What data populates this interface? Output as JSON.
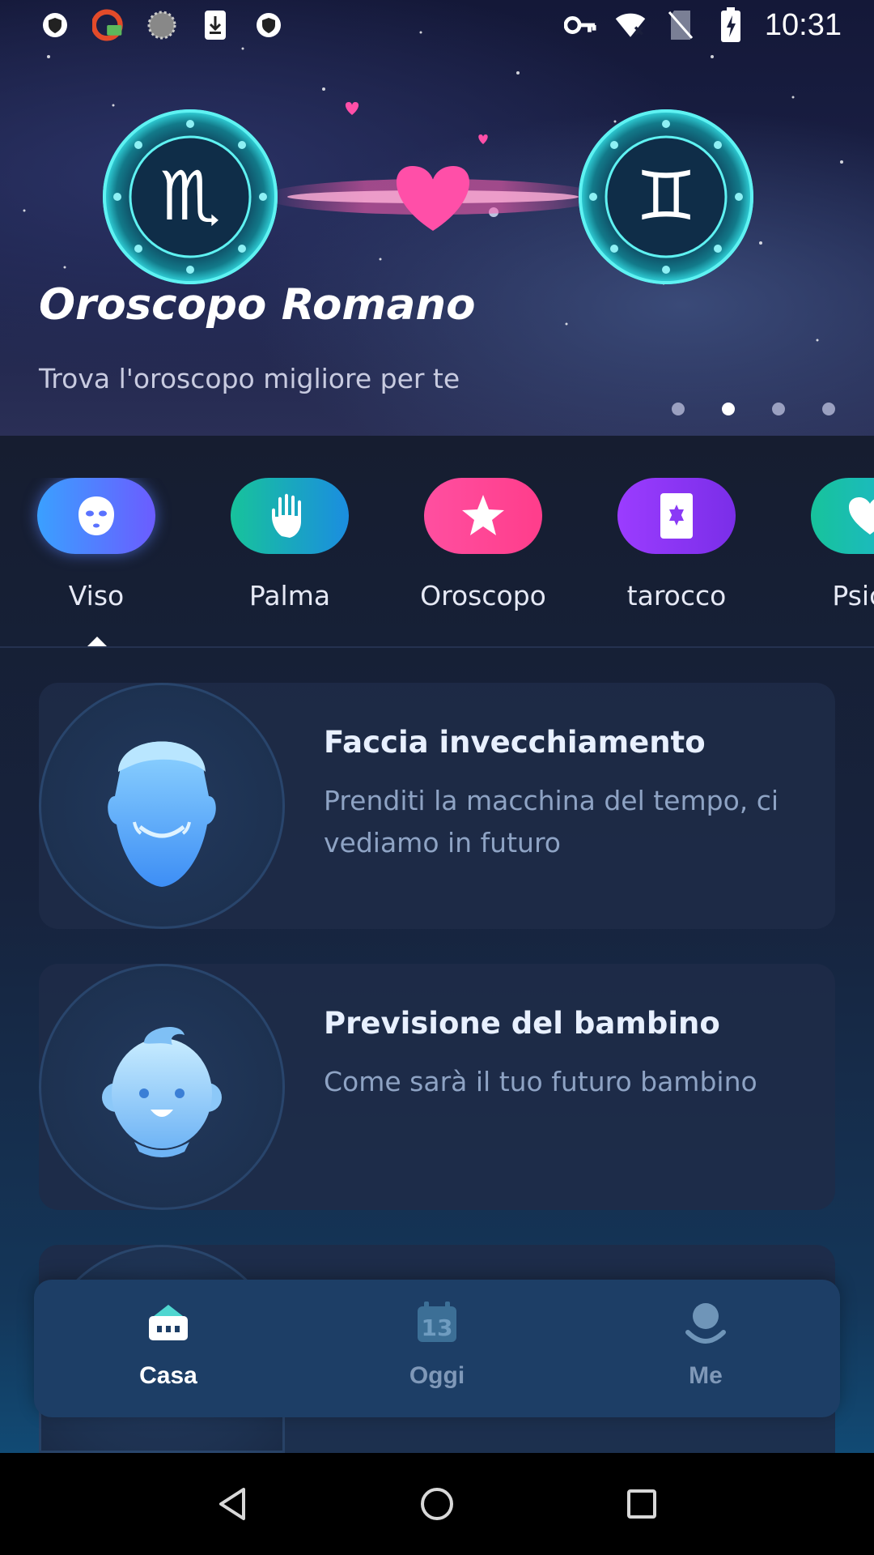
{
  "status_bar": {
    "time": "10:31",
    "left_icons": [
      "shield-icon",
      "cast-icon",
      "spinner-icon",
      "download-icon",
      "shield-icon"
    ],
    "right_icons": [
      "key-icon",
      "wifi-icon",
      "no-sim-icon",
      "battery-charging-icon"
    ]
  },
  "hero": {
    "title": "Oroscopo Romano",
    "subtitle": "Trova l'oroscopo migliore per te",
    "slides": 4,
    "active_slide": 2
  },
  "categories": {
    "items": [
      {
        "label": "Viso",
        "icon": "face-mask-icon",
        "color_from": "#3aa0ff",
        "color_to": "#6b5cff"
      },
      {
        "label": "Palma",
        "icon": "hand-icon",
        "color_from": "#17c39b",
        "color_to": "#1b8de0"
      },
      {
        "label": "Oroscopo",
        "icon": "star-icon",
        "color_from": "#ff4fa0",
        "color_to": "#ff3d8b"
      },
      {
        "label": "tarocco",
        "icon": "tarot-card-icon",
        "color_from": "#9b3cff",
        "color_to": "#7a2ee8"
      },
      {
        "label": "Psicol",
        "icon": "heart-icon",
        "color_from": "#17c39b",
        "color_to": "#1fb3d8"
      }
    ],
    "selected": "Viso"
  },
  "cards": [
    {
      "title": "Faccia invecchiamento",
      "description": "Prenditi la macchina del tempo, ci vediamo in futuro",
      "icon": "aged-face-icon"
    },
    {
      "title": "Previsione del bambino",
      "description": "Come sarà il tuo futuro bambino",
      "icon": "baby-face-icon"
    }
  ],
  "bottom_nav": {
    "items": [
      {
        "label": "Casa",
        "icon": "home-icon",
        "active": true
      },
      {
        "label": "Oggi",
        "icon": "calendar-icon",
        "calendar_day": "13",
        "active": false
      },
      {
        "label": "Me",
        "icon": "profile-icon",
        "active": false
      }
    ]
  },
  "system_nav": [
    "back-icon",
    "home-circle-icon",
    "recents-icon"
  ]
}
